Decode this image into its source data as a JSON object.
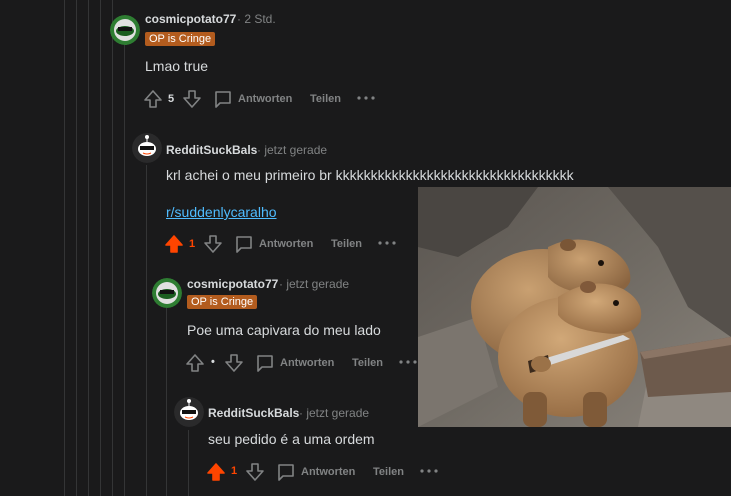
{
  "comments": [
    {
      "author": "cosmicpotato77",
      "time": "· 2 Std.",
      "flair": "OP is Cringe",
      "body": "Lmao true",
      "score": "5",
      "reply": "Antworten",
      "share": "Teilen",
      "upvoted": false
    },
    {
      "author": "RedditSuckBals",
      "time": "· jetzt gerade",
      "body": "krl achei o meu primeiro br kkkkkkkkkkkkkkkkkkkkkkkkkkkkkkkkkk",
      "link": "r/suddenlycaralho",
      "score": "1",
      "reply": "Antworten",
      "share": "Teilen",
      "upvoted": true
    },
    {
      "author": "cosmicpotato77",
      "time": "· jetzt gerade",
      "flair": "OP is Cringe",
      "body": "Poe uma capivara do meu lado",
      "score": "•",
      "reply": "Antworten",
      "share": "Teilen",
      "upvoted": false
    },
    {
      "author": "RedditSuckBals",
      "time": "· jetzt gerade",
      "body": "seu pedido é a uma ordem",
      "score": "1",
      "reply": "Antworten",
      "share": "Teilen",
      "upvoted": true
    }
  ],
  "colors": {
    "background": "#1a1a1b",
    "upvote_active": "#ff4500",
    "link": "#4fbcff",
    "flair_bg": "#b35c1e",
    "muted": "#818384"
  },
  "icons": [
    "upvote-icon",
    "downvote-icon",
    "comment-icon",
    "more-icon",
    "avatar-icon"
  ]
}
